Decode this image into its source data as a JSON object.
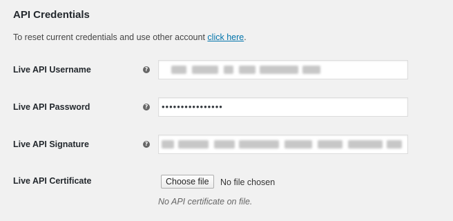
{
  "section": {
    "title": "API Credentials",
    "intro_text": "To reset current credentials and use other account ",
    "intro_link": "click here",
    "intro_tail": "."
  },
  "fields": {
    "username": {
      "label": "Live API Username",
      "help": "?",
      "value_state": "obscured"
    },
    "password": {
      "label": "Live API Password",
      "help": "?",
      "value": "••••••••••••••••"
    },
    "signature": {
      "label": "Live API Signature",
      "help": "?",
      "value_state": "obscured"
    },
    "certificate": {
      "label": "Live API Certificate",
      "button_label": "Choose file",
      "status": "No file chosen",
      "note": "No API certificate on file."
    }
  },
  "colors": {
    "background": "#f1f1f1",
    "link": "#0073aa",
    "help_icon": "#666666"
  },
  "icons": {
    "help": "help-tip-icon"
  }
}
